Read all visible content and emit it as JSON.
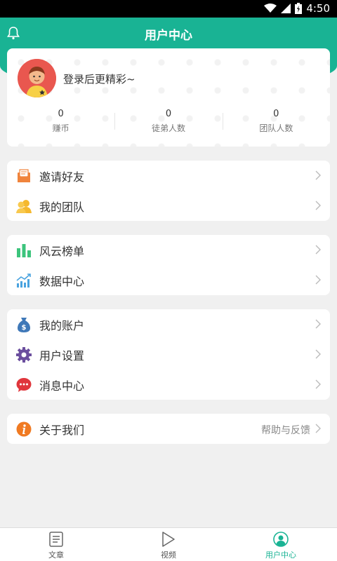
{
  "status_bar": {
    "time": "4:50"
  },
  "header": {
    "title": "用户中心"
  },
  "profile": {
    "login_prompt": "登录后更精彩~",
    "stats": [
      {
        "value": "0",
        "label": "赚币"
      },
      {
        "value": "0",
        "label": "徒弟人数"
      },
      {
        "value": "0",
        "label": "团队人数"
      }
    ]
  },
  "menu": {
    "invite": "邀请好友",
    "team": "我的团队",
    "ranking": "风云榜单",
    "data_center": "数据中心",
    "account": "我的账户",
    "settings": "用户设置",
    "messages": "消息中心",
    "about": "关于我们",
    "help_feedback": "帮助与反馈"
  },
  "tabs": [
    {
      "label": "文章"
    },
    {
      "label": "视频"
    },
    {
      "label": "用户中心"
    }
  ],
  "colors": {
    "brand": "#19b394",
    "invite": "#f0843c",
    "team": "#f5b82e",
    "ranking": "#3cc47c",
    "data": "#4aa3df",
    "account": "#3f78b8",
    "settings": "#6b4e9e",
    "messages": "#e0363c",
    "about": "#f07a22"
  }
}
